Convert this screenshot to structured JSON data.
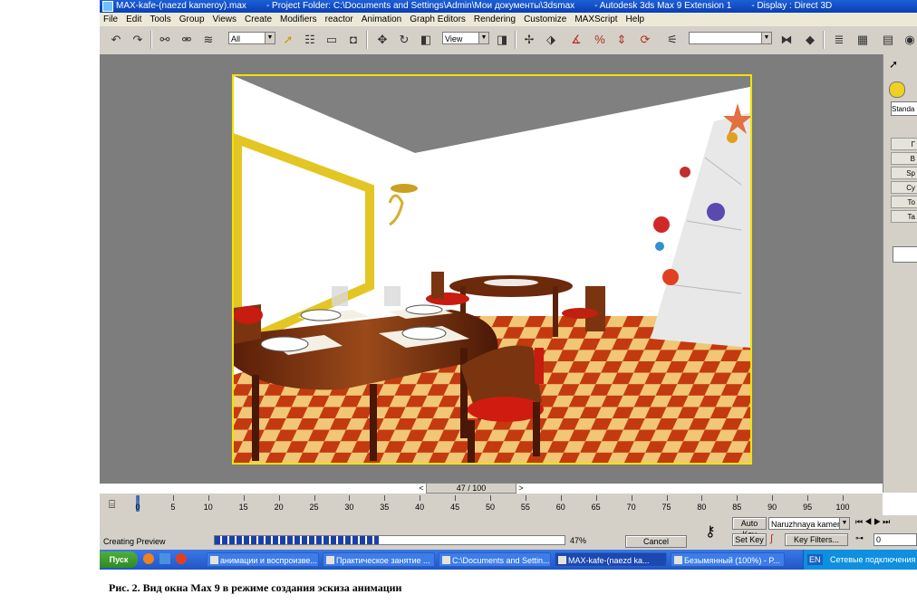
{
  "window": {
    "title_file": "MAX-kafe-(naezd kameroy).max",
    "title_folder": "- Project Folder: C:\\Documents and Settings\\Admin\\Мои документы\\3dsmax",
    "title_app": "- Autodesk 3ds Max 9 Extension 1",
    "title_display": "- Display : Direct 3D"
  },
  "menu": [
    "File",
    "Edit",
    "Tools",
    "Group",
    "Views",
    "Create",
    "Modifiers",
    "reactor",
    "Animation",
    "Graph Editors",
    "Rendering",
    "Customize",
    "MAXScript",
    "Help"
  ],
  "toolbar": {
    "selection_filter": "All",
    "ref_coord": "View",
    "icons": [
      "undo-icon",
      "redo-icon",
      "link-icon",
      "unlink-icon",
      "bind-space-warp-icon",
      "select-object-icon",
      "select-by-name-icon",
      "rect-region-icon",
      "window-crossing-icon",
      "move-icon",
      "rotate-icon",
      "scale-icon",
      "pivot-icon",
      "manipulate-icon",
      "snap-icon",
      "angle-snap-icon",
      "percent-snap-icon",
      "spinner-snap-icon",
      "named-selection-icon",
      "mirror-icon",
      "align-icon",
      "layer-icon",
      "curve-editor-icon",
      "schematic-icon",
      "material-editor-icon"
    ]
  },
  "command_panel": {
    "dropdown": "Standa",
    "buttons": [
      "Г",
      "B",
      "Sp",
      "Cy",
      "To",
      "Ta"
    ]
  },
  "time_slider": {
    "label": "47 / 100",
    "current": 47,
    "total": 100,
    "prev": "<",
    "next": ">"
  },
  "trackbar": {
    "ticks": [
      "0",
      "5",
      "10",
      "15",
      "20",
      "25",
      "30",
      "35",
      "40",
      "45",
      "50",
      "55",
      "60",
      "65",
      "70",
      "75",
      "80",
      "85",
      "90",
      "95",
      "100"
    ]
  },
  "status": {
    "message": "Creating Preview",
    "progress_percent": "47%",
    "progress_fraction": 0.47,
    "cancel": "Cancel",
    "auto_key": "Auto Key",
    "set_key": "Set Key",
    "key_filters": "Key Filters...",
    "camera": "Naruzhnaya kamer",
    "frame": "0"
  },
  "taskbar": {
    "start": "Пуск",
    "tasks": [
      "анимации и воспроизве...",
      "Практическое занятие ...",
      "C:\\Documents and Settin...",
      "MAX-kafe-(naezd ka...",
      "Безымянный (100%) - P..."
    ],
    "active_index": 3,
    "lang": "EN",
    "tray": "Сетевые подключения"
  },
  "caption": "Рис. 2. Вид окна Max 9 в режиме создания эскиза анимации"
}
